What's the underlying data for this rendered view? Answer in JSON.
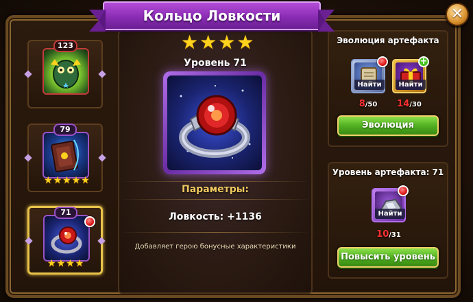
{
  "window": {
    "title": "Кольцо Ловкости",
    "close_icon": "close-icon"
  },
  "left_slots": [
    {
      "level": "123",
      "icon": "jade-idol-icon",
      "stars": 0,
      "selected": false,
      "has_alert": false
    },
    {
      "level": "79",
      "icon": "spellbook-icon",
      "stars": 5,
      "selected": false,
      "has_alert": false
    },
    {
      "level": "71",
      "icon": "agility-ring-icon",
      "stars": 4,
      "selected": true,
      "has_alert": true
    }
  ],
  "artifact": {
    "stars": 4,
    "level_label": "Уровень 71",
    "params_title": "Параметры:",
    "stat_line": "Ловкость: +1136",
    "description": "Добавляет герою бонусные характеристики"
  },
  "evolution": {
    "title": "Эволюция артефакта",
    "materials": [
      {
        "icon": "scroll-icon",
        "find_label": "Найти",
        "have": "8",
        "need": "/50",
        "has_alert": true
      },
      {
        "icon": "gift-chest-icon",
        "find_label": "Найти",
        "have": "14",
        "need": "/30",
        "has_plus": true
      }
    ],
    "button_label": "Эволюция"
  },
  "upgrade": {
    "title": "Уровень артефакта: 71",
    "material": {
      "icon": "silver-ore-icon",
      "find_label": "Найти",
      "have": "10",
      "need": "/31",
      "has_alert": true
    },
    "button_label": "Повысить уровень"
  },
  "colors": {
    "ribbon": "#8a2cb4",
    "gold_text": "#f0c860",
    "alert_red": "#e01818",
    "button_green": "#52b022"
  }
}
